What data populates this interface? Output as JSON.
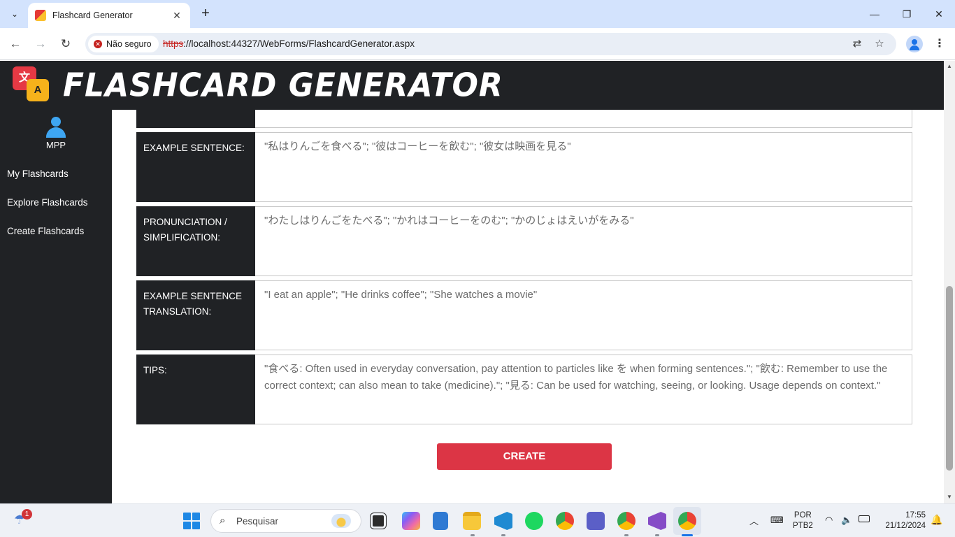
{
  "browser": {
    "tab_title": "Flashcard Generator",
    "security_label": "Não seguro",
    "url_scheme": "https",
    "url_rest": "://localhost:44327/WebForms/FlashcardGenerator.aspx"
  },
  "app": {
    "title": "FLASHCARD GENERATOR",
    "logo_glyph_1": "文",
    "logo_glyph_2": "A"
  },
  "sidebar": {
    "user": "MPP",
    "items": [
      {
        "label": "My Flashcards"
      },
      {
        "label": "Explore Flashcards"
      },
      {
        "label": "Create Flashcards"
      }
    ]
  },
  "form": {
    "rows": [
      {
        "label": "EXAMPLE SENTENCE:",
        "value": "\"私はりんごを食べる\"; \"彼はコーヒーを飲む\"; \"彼女は映画を見る\""
      },
      {
        "label": "PRONUNCIATION / SIMPLIFICATION:",
        "value": "\"わたしはりんごをたべる\"; \"かれはコーヒーをのむ\"; \"かのじょはえいがをみる\""
      },
      {
        "label": "EXAMPLE SENTENCE TRANSLATION:",
        "value": "\"I eat an apple\"; \"He drinks coffee\"; \"She watches a movie\""
      },
      {
        "label": "TIPS:",
        "value": "\"食べる: Often used in everyday conversation, pay attention to particles like を when forming sentences.\"; \"飲む: Remember to use the correct context; can also mean to take (medicine).\"; \"見る: Can be used for watching, seeing, or looking. Usage depends on context.\""
      }
    ],
    "create_label": "CREATE"
  },
  "taskbar": {
    "weather_badge": "1",
    "search_placeholder": "Pesquisar",
    "lang_1": "POR",
    "lang_2": "PTB2",
    "time": "17:55",
    "date": "21/12/2024"
  },
  "colors": {
    "header_bg": "#202225",
    "create_button": "#dc3545",
    "avatar": "#3ea6f2"
  }
}
